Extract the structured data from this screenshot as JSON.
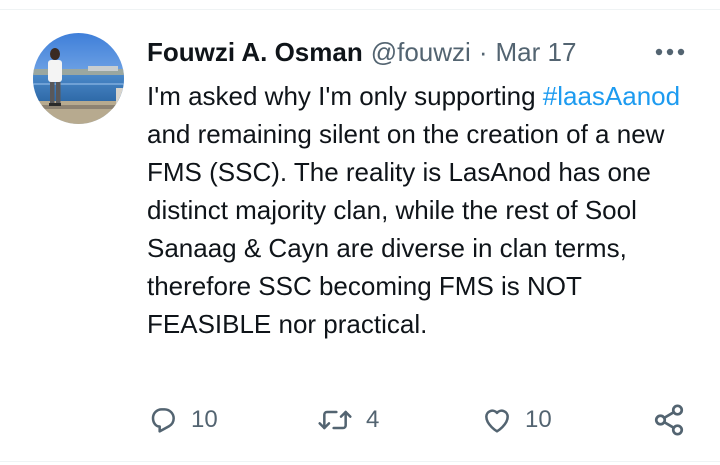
{
  "tweet": {
    "author_name": "Fouwzi A. Osman",
    "handle": "@fouwzi",
    "separator": "·",
    "date": "Mar 17",
    "avatar_icon": "avatar-person-by-water-photo",
    "text_before": "I'm asked why I'm only supporting ",
    "hashtag": "#laasAanod",
    "text_after": " and remaining silent on the creation of a new FMS (SSC). The reality is LasAnod has one distinct majority clan, while the rest of Sool Sanaag & Cayn are diverse in clan terms, therefore SSC becoming FMS is NOT FEASIBLE nor practical."
  },
  "actions": {
    "reply": {
      "icon": "reply-icon",
      "count": "10"
    },
    "retweet": {
      "icon": "retweet-icon",
      "count": "4"
    },
    "like": {
      "icon": "like-heart-icon",
      "count": "10"
    },
    "share": {
      "icon": "share-icon"
    },
    "more": {
      "icon": "more-dots-icon"
    }
  },
  "colors": {
    "text": "#0f1419",
    "secondary": "#536471",
    "link": "#1d9bf0",
    "divider": "#eff3f4"
  }
}
